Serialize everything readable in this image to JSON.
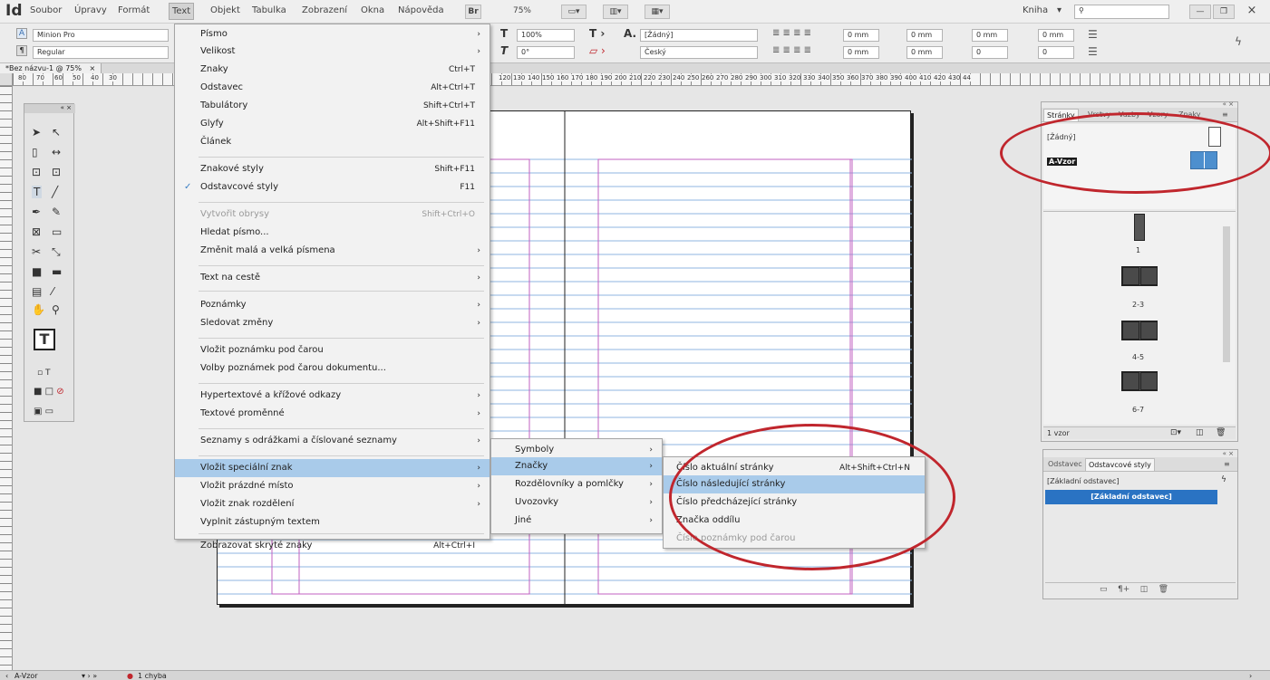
{
  "app": {
    "logo": "Id"
  },
  "menubar": {
    "items": [
      "Soubor",
      "Úpravy",
      "Formát",
      "Text",
      "Objekt",
      "Tabulka",
      "Zobrazení",
      "Okna",
      "Nápověda"
    ],
    "bridge": "Br",
    "zoom": "75%",
    "workspace": "Kniha",
    "search_placeholder": ""
  },
  "control": {
    "font": "Minion Pro",
    "style": "Regular",
    "scale_h": "100%",
    "skew": "0°",
    "char_style": "[Žádný]",
    "language": "Český",
    "indent1": "0 mm",
    "indent2": "0 mm",
    "indent3": "0 mm",
    "indent4": "0 mm",
    "space1": "0 mm",
    "space2": "0 mm",
    "count1": "0",
    "count2": "0"
  },
  "document": {
    "tab_label": "*Bez názvu-1 @ 75%",
    "close": "×"
  },
  "ruler": {
    "labels": [
      "80",
      "70",
      "60",
      "50",
      "40",
      "30",
      "120",
      "130",
      "140",
      "150",
      "160",
      "170",
      "180",
      "190",
      "200",
      "210",
      "220",
      "230",
      "240",
      "250",
      "260",
      "270",
      "280",
      "290",
      "300",
      "310",
      "320",
      "330",
      "340",
      "350",
      "360",
      "370",
      "380",
      "390",
      "400",
      "410",
      "420",
      "430",
      "44"
    ]
  },
  "text_menu": {
    "items": [
      {
        "label": "Písmo",
        "shortcut": "",
        "arrow": true
      },
      {
        "label": "Velikost",
        "shortcut": "",
        "arrow": true
      },
      {
        "label": "Znaky",
        "shortcut": "Ctrl+T"
      },
      {
        "label": "Odstavec",
        "shortcut": "Alt+Ctrl+T"
      },
      {
        "label": "Tabulátory",
        "shortcut": "Shift+Ctrl+T"
      },
      {
        "label": "Glyfy",
        "shortcut": "Alt+Shift+F11"
      },
      {
        "label": "Článek",
        "shortcut": ""
      },
      {
        "label": "Znakové styly",
        "shortcut": "Shift+F11"
      },
      {
        "label": "Odstavcové styly",
        "shortcut": "F11",
        "checked": true
      },
      {
        "label": "Vytvořit obrysy",
        "shortcut": "Shift+Ctrl+O",
        "disabled": true
      },
      {
        "label": "Hledat písmo...",
        "shortcut": ""
      },
      {
        "label": "Změnit malá a velká písmena",
        "shortcut": "",
        "arrow": true
      },
      {
        "label": "Text na cestě",
        "shortcut": "",
        "arrow": true
      },
      {
        "label": "Poznámky",
        "shortcut": "",
        "arrow": true
      },
      {
        "label": "Sledovat změny",
        "shortcut": "",
        "arrow": true
      },
      {
        "label": "Vložit poznámku pod čarou",
        "shortcut": ""
      },
      {
        "label": "Volby poznámek pod čarou dokumentu...",
        "shortcut": ""
      },
      {
        "label": "Hypertextové a křížové odkazy",
        "shortcut": "",
        "arrow": true
      },
      {
        "label": "Textové proměnné",
        "shortcut": "",
        "arrow": true
      },
      {
        "label": "Seznamy s odrážkami a číslované seznamy",
        "shortcut": "",
        "arrow": true
      },
      {
        "label": "Vložit speciální znak",
        "shortcut": "",
        "arrow": true,
        "highlight": true
      },
      {
        "label": "Vložit prázdné místo",
        "shortcut": "",
        "arrow": true
      },
      {
        "label": "Vložit znak rozdělení",
        "shortcut": "",
        "arrow": true
      },
      {
        "label": "Vyplnit zástupným textem",
        "shortcut": ""
      },
      {
        "label": "Zobrazovat skryté znaky",
        "shortcut": "Alt+Ctrl+I"
      }
    ]
  },
  "special_menu": {
    "items": [
      {
        "label": "Symboly"
      },
      {
        "label": "Značky",
        "highlight": true
      },
      {
        "label": "Rozdělovníky a pomlčky"
      },
      {
        "label": "Uvozovky"
      },
      {
        "label": "Jiné"
      }
    ]
  },
  "marks_menu": {
    "items": [
      {
        "label": "Číslo aktuální stránky",
        "shortcut": "Alt+Shift+Ctrl+N"
      },
      {
        "label": "Číslo následující stránky",
        "shortcut": "",
        "highlight": true
      },
      {
        "label": "Číslo předcházející stránky",
        "shortcut": ""
      },
      {
        "label": "Značka oddílu",
        "shortcut": ""
      },
      {
        "label": "Číslo poznámky pod čarou",
        "shortcut": "",
        "disabled": true
      }
    ]
  },
  "pages_panel": {
    "tabs": [
      "Stránky",
      "Vrstvy",
      "Vazby",
      "Vzory",
      "Znaky"
    ],
    "none_master": "[Žádný]",
    "master": "A-Vzor",
    "page_labels": [
      "1",
      "2-3",
      "4-5",
      "6-7"
    ],
    "footer": "1 vzor"
  },
  "styles_panel": {
    "tabs": [
      "Odstavec",
      "Odstavcové styly"
    ],
    "current": "[Základní odstavec]",
    "item": "[Základní odstavec]"
  },
  "statusbar": {
    "page": "A-Vzor",
    "errors": "1 chyba"
  },
  "colors": {
    "accent": "#a9cbea",
    "annotation": "#c0262d",
    "guide_blue": "#8fb6e0",
    "guide_magenta": "#c060c0"
  }
}
